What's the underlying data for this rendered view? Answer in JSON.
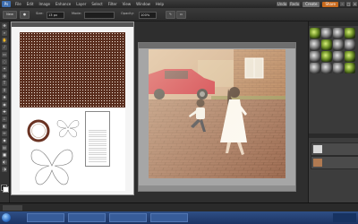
{
  "menubar": {
    "logo": "Ps",
    "items": [
      "File",
      "Edit",
      "Image",
      "Enhance",
      "Layer",
      "Select",
      "Filter",
      "View",
      "Window",
      "Help"
    ],
    "undo": "Undo",
    "redo": "Redo",
    "create": "Create",
    "share": "Share"
  },
  "options": {
    "new_btn": "New",
    "mode_label": "Mode:",
    "opacity_label": "Opacity:",
    "opacity_value": "100%",
    "size_label": "Size:",
    "size_value": "13 px"
  },
  "doc1": {
    "title": "",
    "card_heading": "",
    "footer": ""
  },
  "doc2": {
    "title": ""
  },
  "panel": {
    "effects_title": "",
    "layers_title": "",
    "layers": [
      "",
      ""
    ]
  },
  "projbar": {
    "button": ""
  },
  "taskbar": {
    "tasks": [
      "",
      "",
      "",
      ""
    ],
    "clock": ""
  },
  "colors": {
    "accent_share": "#c86a1d",
    "pattern_brown": "#5a2e1e",
    "taskbar_blue": "#2e4f86"
  }
}
